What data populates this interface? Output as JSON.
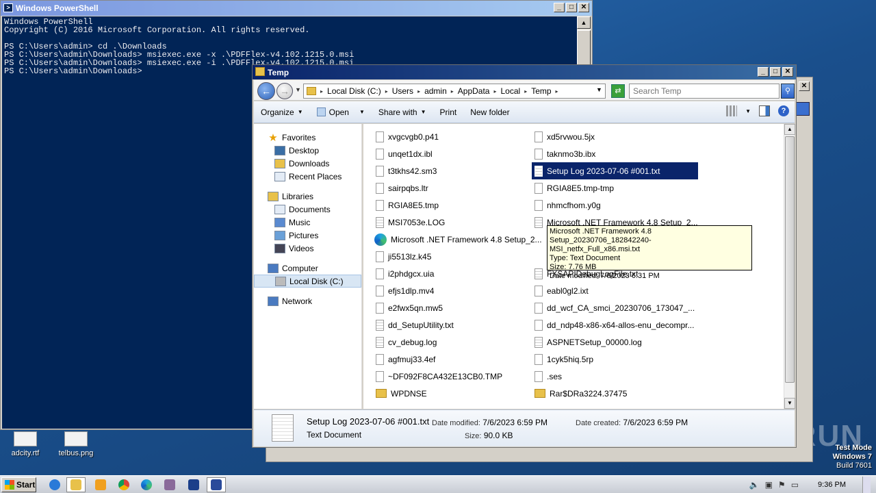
{
  "desktop": {
    "icons": [
      {
        "label": "adcity.rtf"
      },
      {
        "label": "telbus.png"
      }
    ],
    "watermark": "ANY RUN",
    "test_mode": {
      "line1": "Test Mode",
      "line2": "Windows 7",
      "line3": "Build 7601"
    }
  },
  "powershell": {
    "title": "Windows PowerShell",
    "console_lines": [
      "Windows PowerShell",
      "Copyright (C) 2016 Microsoft Corporation. All rights reserved.",
      "",
      "PS C:\\Users\\admin> cd .\\Downloads",
      "PS C:\\Users\\admin\\Downloads> msiexec.exe -x .\\PDFFlex-v4.102.1215.0.msi",
      "PS C:\\Users\\admin\\Downloads> msiexec.exe -i .\\PDFFlex-v4.102.1215.0.msi",
      "PS C:\\Users\\admin\\Downloads>"
    ]
  },
  "explorer": {
    "title": "Temp",
    "breadcrumb": [
      "Local Disk (C:)",
      "Users",
      "admin",
      "AppData",
      "Local",
      "Temp"
    ],
    "search_placeholder": "Search Temp",
    "commands": {
      "organize": "Organize",
      "open": "Open",
      "share": "Share with",
      "print": "Print",
      "new_folder": "New folder"
    },
    "nav": {
      "favorites": "Favorites",
      "desktop": "Desktop",
      "downloads": "Downloads",
      "recent": "Recent Places",
      "libraries": "Libraries",
      "documents": "Documents",
      "music": "Music",
      "pictures": "Pictures",
      "videos": "Videos",
      "computer": "Computer",
      "local_disk": "Local Disk (C:)",
      "network": "Network"
    },
    "files_left": [
      "xvgcvgb0.p41",
      "unqet1dx.ibl",
      "t3tkhs42.sm3",
      "sairpqbs.ltr",
      "RGIA8E5.tmp",
      "MSI7053e.LOG",
      "Microsoft .NET Framework 4.8 Setup_2...",
      "ji5513lz.k45",
      "i2phdgcx.uia",
      "efjs1dlp.mv4",
      "e2fwx5qn.mw5",
      "dd_SetupUtility.txt",
      "cv_debug.log",
      "agfmuj33.4ef",
      "~DF092F8CA432E13CB0.TMP",
      "WPDNSE"
    ],
    "files_right": [
      "xd5rvwou.5jx",
      "taknmo3b.ibx",
      "Setup Log 2023-07-06 #001.txt",
      "RGIA8E5.tmp-tmp",
      "nhmcfhom.y0g",
      "Microsoft .NET Framework 4.8 Setup_2...",
      "",
      "",
      "FXSAPIDebugLogFile.txt",
      "eabl0gl2.ixt",
      "dd_wcf_CA_smci_20230706_173047_...",
      "dd_ndp48-x86-x64-allos-enu_decompr...",
      "ASPNETSetup_00000.log",
      "1cyk5hiq.5rp",
      ".ses",
      "Rar$DRa3224.37475"
    ],
    "tooltip": {
      "line1": "Microsoft .NET Framework 4.8 Setup_20230706_182842240-",
      "line2": "MSI_netfx_Full_x86.msi.txt",
      "line3": "Type: Text Document",
      "line4": "Size: 7.76 MB",
      "line5": "Date modified: 7/6/2023 6:31 PM"
    },
    "details": {
      "name": "Setup Log 2023-07-06 #001.txt",
      "type": "Text Document",
      "modified_label": "Date modified:",
      "modified": "7/6/2023 6:59 PM",
      "size_label": "Size:",
      "size": "90.0 KB",
      "created_label": "Date created:",
      "created": "7/6/2023 6:59 PM"
    }
  },
  "taskbar": {
    "start": "Start",
    "clock": "9:36 PM"
  }
}
